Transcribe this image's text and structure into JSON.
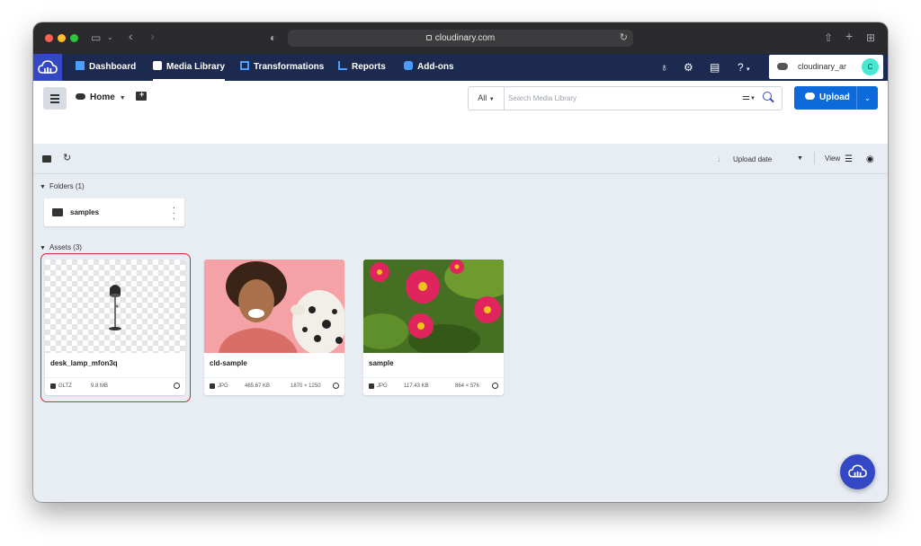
{
  "browser": {
    "url": "cloudinary.com"
  },
  "nav": {
    "items": [
      {
        "label": "Dashboard"
      },
      {
        "label": "Media Library"
      },
      {
        "label": "Transformations"
      },
      {
        "label": "Reports"
      },
      {
        "label": "Add-ons"
      }
    ],
    "account_name": "cloudinary_ar",
    "avatar_letter": "C"
  },
  "toolbar": {
    "home_label": "Home",
    "search_scope": "All",
    "search_placeholder": "Search Media Library",
    "upload_label": "Upload"
  },
  "subbar": {
    "sort_label": "Upload date",
    "view_label": "View"
  },
  "folders": {
    "header": "Folders (1)",
    "items": [
      {
        "name": "samples"
      }
    ]
  },
  "assets": {
    "header": "Assets (3)",
    "items": [
      {
        "name": "desk_lamp_mfon3q",
        "format": "GLTZ",
        "size": "9.8 MB",
        "dimensions": ""
      },
      {
        "name": "cld-sample",
        "format": "JPG",
        "size": "465.67 KB",
        "dimensions": "1870 × 1250"
      },
      {
        "name": "sample",
        "format": "JPG",
        "size": "117.43 KB",
        "dimensions": "864 × 576"
      }
    ]
  },
  "colors": {
    "nav_bg": "#1b2a4e",
    "brand": "#3448c5",
    "upload_button": "#0d6adb",
    "selection_outline": "#e0262b"
  }
}
